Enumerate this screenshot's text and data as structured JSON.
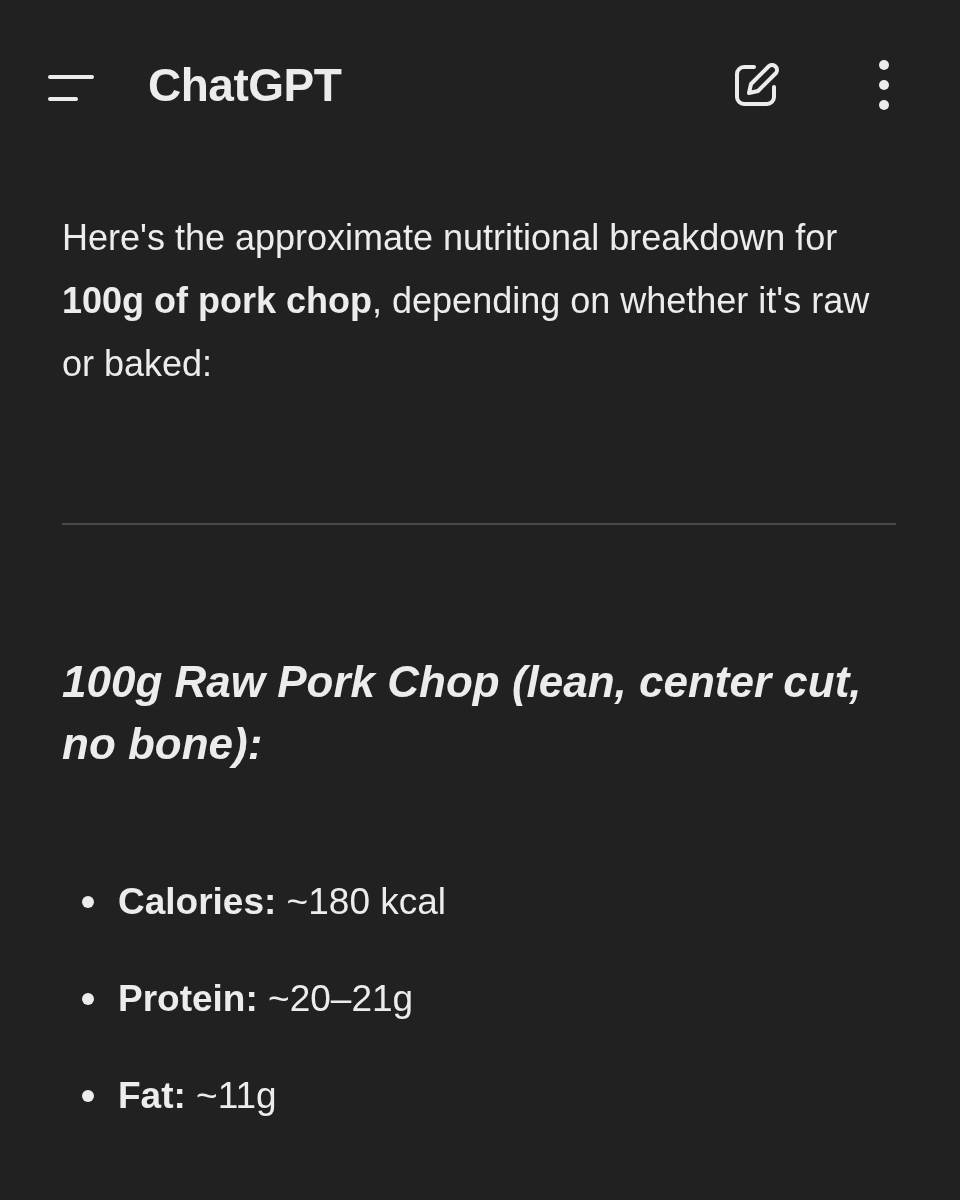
{
  "header": {
    "title": "ChatGPT"
  },
  "message": {
    "intro": "Here's the approximate nutritional breakdown for **100g of pork chop**, depending on whether it's raw or baked:",
    "heading": "100g Raw Pork Chop (lean, center cut, no bone):",
    "items": [
      {
        "text": "**Calories:** ~180 kcal"
      },
      {
        "text": "**Protein:** ~20–21g"
      },
      {
        "text": "**Fat:** ~11g"
      }
    ]
  }
}
